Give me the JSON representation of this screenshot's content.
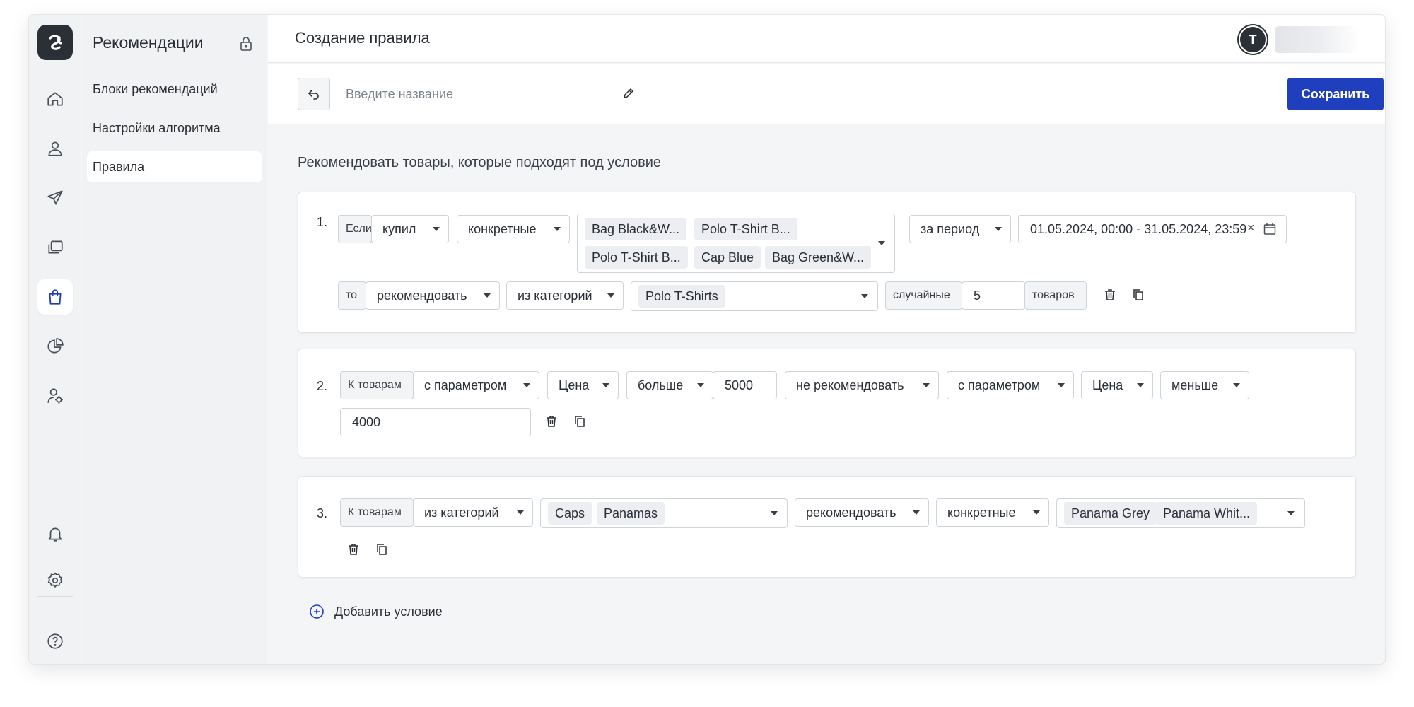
{
  "brand": {
    "accent": "#1f3fbf",
    "dark": "#2b2f36"
  },
  "rail": {
    "logo_icon": "logo-knot",
    "items": [
      {
        "icon": "home-icon"
      },
      {
        "icon": "user-icon"
      },
      {
        "icon": "send-icon"
      },
      {
        "icon": "copy-windows-icon"
      },
      {
        "icon": "shopping-bag-icon",
        "active": true
      },
      {
        "icon": "pie-chart-icon"
      },
      {
        "icon": "user-settings-icon"
      },
      {
        "icon": "bell-icon"
      },
      {
        "icon": "gear-icon"
      },
      {
        "icon": "help-icon"
      }
    ]
  },
  "subnav": {
    "title": "Рекомендации",
    "items": [
      {
        "label": "Блоки рекомендаций"
      },
      {
        "label": "Настройки алгоритма"
      },
      {
        "label": "Правила",
        "active": true
      }
    ]
  },
  "header": {
    "title": "Создание правила",
    "avatar_initial": "T"
  },
  "toolbar": {
    "name_placeholder": "Введите название",
    "save_label": "Сохранить"
  },
  "main": {
    "subtitle": "Рекомендовать товары, которые подходят под условие",
    "add_condition": "Добавить условие"
  },
  "rules": [
    {
      "number": "1.",
      "if_label": "Если",
      "action": "купил",
      "products_mode": "конкретные",
      "products": [
        "Bag Black&W...",
        "Polo T-Shirt B...",
        "Polo T-Shirt B...",
        "Cap Blue",
        "Bag Green&W..."
      ],
      "period_label": "за период",
      "date_range": "01.05.2024, 00:00 - 31.05.2024, 23:59",
      "then_label": "то",
      "recommend": "рекомендовать",
      "source": "из категорий",
      "categories": [
        "Polo T-Shirts"
      ],
      "order": "случайные",
      "count": "5",
      "count_unit": "товаров"
    },
    {
      "number": "2.",
      "to_label": "К товарам",
      "param1": "с параметром",
      "field1": "Цена",
      "op1": "больше",
      "value1": "5000",
      "recommend": "не рекомендовать",
      "param2": "с параметром",
      "field2": "Цена",
      "op2": "меньше",
      "value2": "4000"
    },
    {
      "number": "3.",
      "to_label": "К товарам",
      "source": "из категорий",
      "categories": [
        "Caps",
        "Panamas"
      ],
      "recommend": "рекомендовать",
      "products_mode": "конкретные",
      "products": [
        "Panama Grey",
        "Panama Whit..."
      ]
    }
  ]
}
